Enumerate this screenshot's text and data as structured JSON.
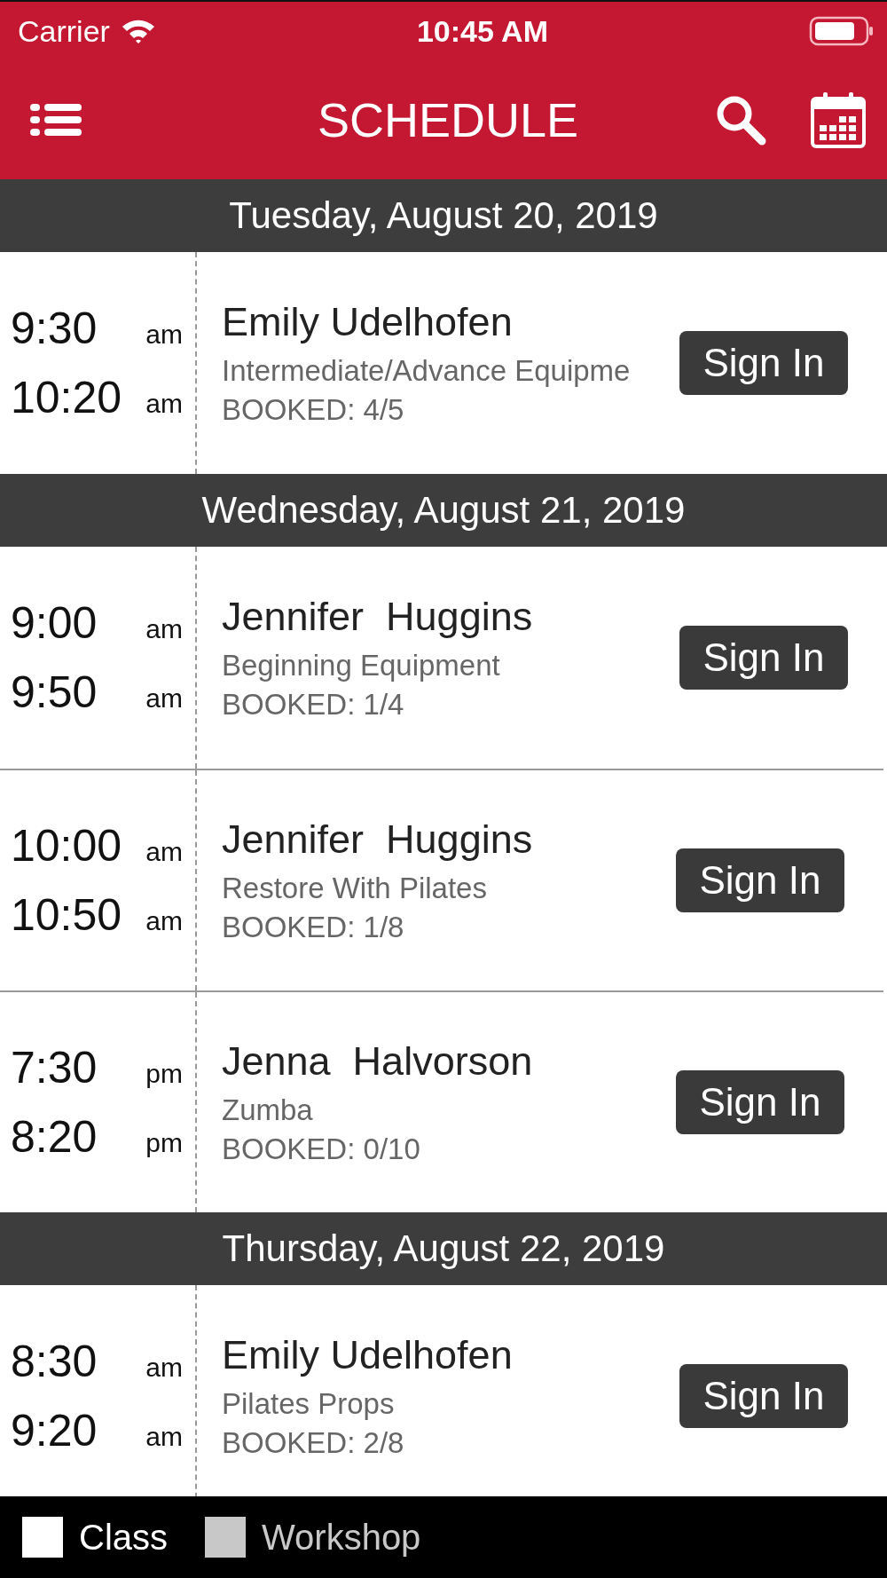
{
  "status_bar": {
    "carrier": "Carrier",
    "time": "10:45 AM"
  },
  "nav": {
    "title": "SCHEDULE"
  },
  "days": [
    {
      "date": "Tuesday, August 20, 2019",
      "sessions": [
        {
          "start": "9:30",
          "start_period": "am",
          "end": "10:20",
          "end_period": "am",
          "instructor": "Emily Udelhofen",
          "class_name": "Intermediate/Advance Equipme",
          "booked": "BOOKED: 4/5",
          "button": "Sign In"
        }
      ]
    },
    {
      "date": "Wednesday, August 21, 2019",
      "sessions": [
        {
          "start": "9:00",
          "start_period": "am",
          "end": "9:50",
          "end_period": "am",
          "instructor": "Jennifer  Huggins",
          "class_name": "Beginning Equipment",
          "booked": "BOOKED: 1/4",
          "button": "Sign In"
        },
        {
          "start": "10:00",
          "start_period": "am",
          "end": "10:50",
          "end_period": "am",
          "instructor": "Jennifer  Huggins",
          "class_name": "Restore With Pilates",
          "booked": "BOOKED: 1/8",
          "button": "Sign In"
        },
        {
          "start": "7:30",
          "start_period": "pm",
          "end": "8:20",
          "end_period": "pm",
          "instructor": "Jenna  Halvorson",
          "class_name": "Zumba",
          "booked": "BOOKED: 0/10",
          "button": "Sign In"
        }
      ]
    },
    {
      "date": "Thursday, August 22, 2019",
      "sessions": [
        {
          "start": "8:30",
          "start_period": "am",
          "end": "9:20",
          "end_period": "am",
          "instructor": "Emily Udelhofen",
          "class_name": "Pilates Props",
          "booked": "BOOKED: 2/8",
          "button": "Sign In"
        }
      ]
    }
  ],
  "legend": [
    {
      "label": "Class",
      "color": "#ffffff"
    },
    {
      "label": "Workshop",
      "color": "#c8c8c8"
    }
  ]
}
